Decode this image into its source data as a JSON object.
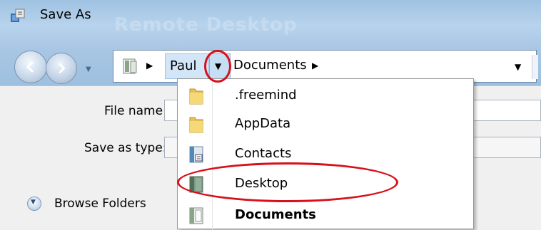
{
  "window": {
    "title": "Save As",
    "ghost_title": "Remote Desktop"
  },
  "address_bar": {
    "crumbs": [
      "Paul",
      "Documents"
    ]
  },
  "form": {
    "file_name_label": "File name:",
    "save_as_type_label": "Save as type:",
    "browse_folders_label": "Browse Folders"
  },
  "dropdown": {
    "items": [
      {
        "label": ".freemind",
        "icon": "folder-icon",
        "bold": false
      },
      {
        "label": "AppData",
        "icon": "folder-icon",
        "bold": false
      },
      {
        "label": "Contacts",
        "icon": "contacts-icon",
        "bold": false
      },
      {
        "label": "Desktop",
        "icon": "desktop-icon",
        "bold": false
      },
      {
        "label": "Documents",
        "icon": "documents-icon",
        "bold": true
      }
    ]
  },
  "annotations": {
    "highlight_color": "#d7101a",
    "highlighted": [
      "crumb-dropdown-button",
      "dropdown-item-desktop"
    ]
  }
}
